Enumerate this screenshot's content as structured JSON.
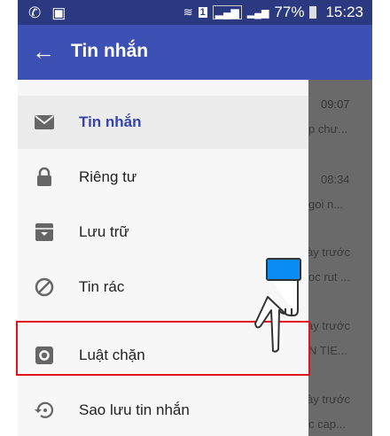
{
  "status_bar": {
    "battery": "77%",
    "time": "15:23",
    "sim": "1"
  },
  "toolbar": {
    "title": "Tin nhắn"
  },
  "drawer": {
    "items": [
      {
        "label": "Tin nhắn",
        "icon": "mail-icon",
        "active": true
      },
      {
        "label": "Riêng tư",
        "icon": "lock-icon"
      },
      {
        "label": "Lưu trữ",
        "icon": "archive-icon"
      },
      {
        "label": "Tin rác",
        "icon": "block-icon"
      },
      {
        "label": "Luật chặn",
        "icon": "settings-icon"
      },
      {
        "label": "Sao lưu tin nhắn",
        "icon": "backup-restore-icon"
      }
    ]
  },
  "background_list": [
    {
      "time": "09:07",
      "snippet": "p chư..."
    },
    {
      "time": "08:34",
      "snippet": "goi n..."
    },
    {
      "time": "ày trước",
      "snippet": "oc rut ..."
    },
    {
      "time": "ày trước",
      "snippet": "N TIE..."
    },
    {
      "time": "ày trước",
      "snippet": "c cap..."
    }
  ],
  "colors": {
    "toolbar": "#3d51b4",
    "status": "#2b3a80",
    "highlight": "#e0141c",
    "accent_text": "#3444a8"
  }
}
